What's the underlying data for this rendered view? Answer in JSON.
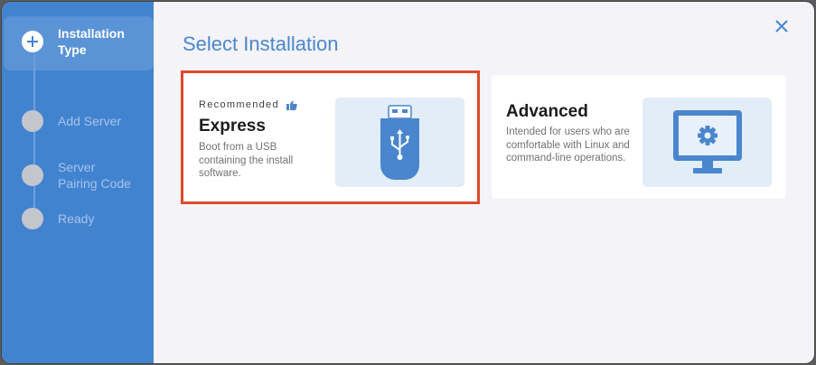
{
  "wizard": {
    "title": "Select Installation",
    "steps": [
      {
        "label": "Installation Type",
        "state": "active"
      },
      {
        "label": "Add Server",
        "state": "pending"
      },
      {
        "label": "Server Pairing Code",
        "state": "pending"
      },
      {
        "label": "Ready",
        "state": "pending"
      }
    ],
    "close_icon": "close-icon"
  },
  "options": {
    "express": {
      "badge": "Recommended",
      "badge_icon": "thumbs-up-icon",
      "title": "Express",
      "description": "Boot from a USB containing the install software.",
      "illustration": "usb-drive-icon",
      "selected": true
    },
    "advanced": {
      "title": "Advanced",
      "description": "Intended for users who are comfortable with Linux and command-line operations.",
      "illustration": "monitor-gear-icon"
    }
  },
  "colors": {
    "sidebar": "#4283d0",
    "accent": "#4a86cd",
    "selection_border": "#dd4a2b",
    "background": "#f3f3f8"
  }
}
